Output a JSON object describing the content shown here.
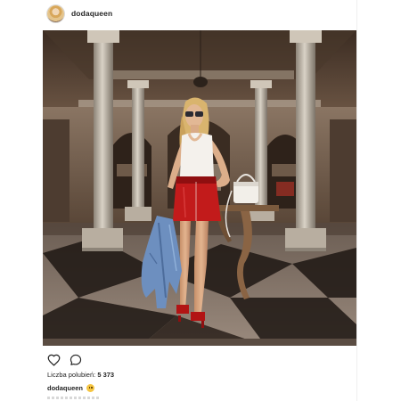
{
  "post": {
    "username": "dodaqueen",
    "avatar_icon": "profile-avatar",
    "photo_description_icon": "post-photo",
    "actions": {
      "like_icon": "heart-icon",
      "comment_icon": "comment-icon"
    },
    "likes": {
      "label": "Liczba polubień:",
      "count": "5 373"
    },
    "caption": {
      "user": "dodaqueen",
      "emoji_icon": "smiling-face-icon"
    }
  },
  "colors": {
    "text": "#262626",
    "border": "#efefef",
    "photo_floor_dark": "#1c1512",
    "photo_floor_light": "#8a7a6c",
    "skirt_red": "#c21b1b"
  }
}
